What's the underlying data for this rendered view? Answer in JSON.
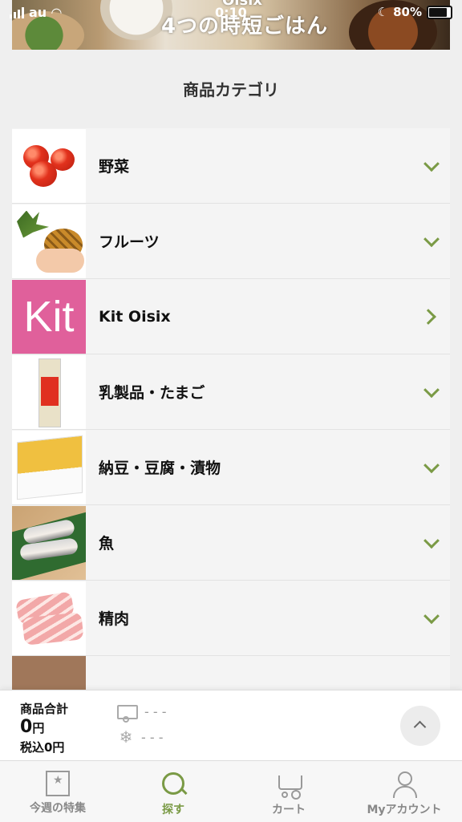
{
  "status_bar": {
    "carrier": "au",
    "time": "0:10",
    "battery": "80%"
  },
  "banner": {
    "brand": "Oisix",
    "title": "4つの時短ごはん"
  },
  "section_heading": "商品カテゴリ",
  "categories": [
    {
      "label": "野菜",
      "thumb": "tomato-image",
      "indicator": "chevron-down-icon"
    },
    {
      "label": "フルーツ",
      "thumb": "pineapple-image",
      "indicator": "chevron-down-icon"
    },
    {
      "label": "Kit Oisix",
      "thumb_text": "Kit",
      "indicator": "chevron-right-icon"
    },
    {
      "label": "乳製品・たまご",
      "thumb": "milk-carton-image",
      "indicator": "chevron-down-icon"
    },
    {
      "label": "納豆・豆腐・漬物",
      "thumb": "natto-image",
      "indicator": "chevron-down-icon"
    },
    {
      "label": "魚",
      "thumb": "fish-image",
      "indicator": "chevron-down-icon"
    },
    {
      "label": "精肉",
      "thumb": "meat-image",
      "indicator": "chevron-down-icon"
    }
  ],
  "cart_bar": {
    "total_label": "商品合計",
    "total_amount": "0",
    "currency": "円",
    "tax_included": "税込0円",
    "delivery_normal": "- - -",
    "delivery_frozen": "- - -"
  },
  "tab_bar": {
    "tabs": [
      {
        "label": "今週の特集",
        "icon": "star-icon",
        "active": false
      },
      {
        "label": "探す",
        "icon": "search-icon",
        "active": true
      },
      {
        "label": "カート",
        "icon": "cart-icon",
        "active": false
      },
      {
        "label": "Myアカウント",
        "icon": "user-icon",
        "active": false
      }
    ]
  },
  "colors": {
    "accent": "#7a9a45",
    "kit_pink": "#e0609b",
    "background": "#efefef"
  }
}
